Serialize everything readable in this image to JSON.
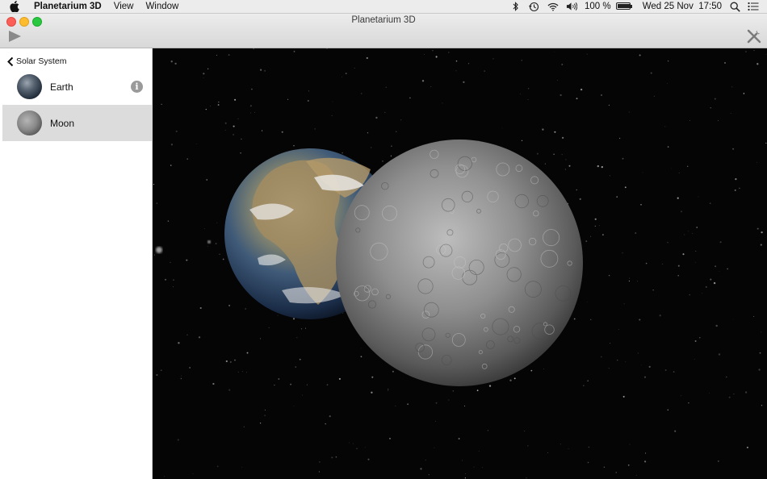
{
  "menubar": {
    "app_name": "Planetarium 3D",
    "menus": [
      "View",
      "Window"
    ],
    "battery_text": "100 %",
    "battery_level": 1.0,
    "datetime": "Wed 25 Nov  17:50",
    "status_icons": [
      "bluetooth-icon",
      "time-machine-icon",
      "wifi-icon",
      "volume-icon",
      "battery-icon",
      "search-icon",
      "list-icon"
    ]
  },
  "window": {
    "title": "Planetarium 3D",
    "toolbar": {
      "play_icon": "play-icon",
      "tools_icon": "tools-icon"
    }
  },
  "sidebar": {
    "back_label": "Solar System",
    "items": [
      {
        "label": "Earth",
        "icon": "earth-thumbnail",
        "has_info": true,
        "selected": false
      },
      {
        "label": "Moon",
        "icon": "moon-thumbnail",
        "has_info": false,
        "selected": true
      }
    ]
  },
  "viewport": {
    "scene": "3D view",
    "bodies": [
      "Earth",
      "Moon"
    ]
  },
  "colors": {
    "sidebar_selected": "#dcdcdc",
    "space": "#050505",
    "close": "#fc5f57",
    "minimize": "#fdbc2e",
    "maximize": "#29c840"
  }
}
